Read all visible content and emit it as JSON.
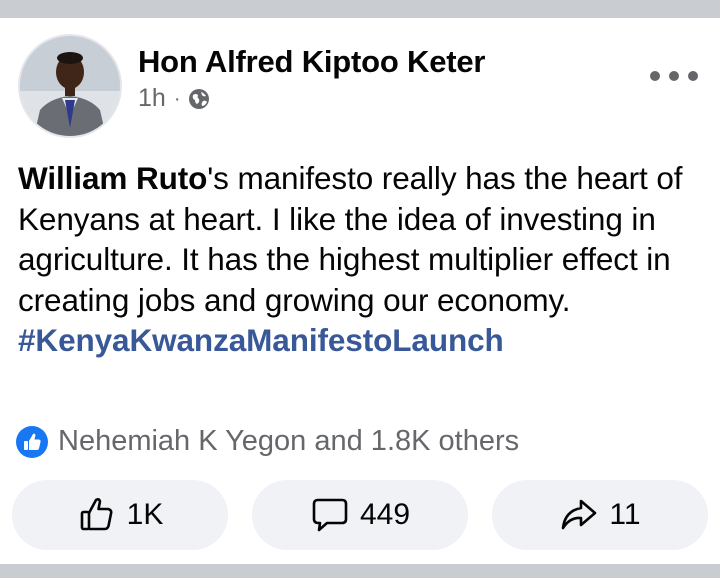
{
  "post": {
    "author": "Hon Alfred Kiptoo Keter",
    "time": "1h",
    "separator": "·",
    "privacy_icon": "globe-icon",
    "text_mention": "William Ruto",
    "text_body": "'s manifesto really has the heart of Kenyans at heart. I like the idea of investing in agriculture. It has the highest multiplier effect in creating jobs and growing our economy.",
    "hashtag": "#KenyaKwanzaManifestoLaunch"
  },
  "reactions": {
    "icon": "like-badge-icon",
    "summary": "Nehemiah K Yegon and 1.8K others"
  },
  "actions": {
    "like_count": "1K",
    "comment_count": "449",
    "share_count": "11"
  },
  "colors": {
    "hashtag": "#385898",
    "like_blue": "#1877f2",
    "secondary_text": "#65676b",
    "button_bg": "#f0f2f5",
    "divider": "#c9ccd1"
  }
}
